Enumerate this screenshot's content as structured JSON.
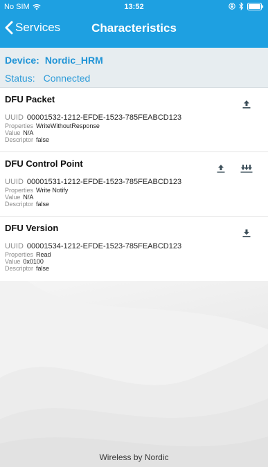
{
  "status_bar": {
    "carrier": "No SIM",
    "time": "13:52",
    "icons": [
      "wifi-icon",
      "rotation-lock-icon",
      "bluetooth-icon",
      "battery-icon"
    ]
  },
  "nav": {
    "back_label": "Services",
    "title": "Characteristics"
  },
  "device": {
    "device_label": "Device:",
    "device_value": "Nordic_HRM",
    "status_label": "Status:",
    "status_value": "Connected"
  },
  "labels": {
    "uuid": "UUID",
    "properties": "Properties",
    "value": "Value",
    "descriptor": "Descriptor"
  },
  "characteristics": [
    {
      "name": "DFU Packet",
      "uuid": "00001532-1212-EFDE-1523-785FEABCD123",
      "properties": "WriteWithoutResponse",
      "value": "N/A",
      "descriptor": "false",
      "actions": [
        "write-icon"
      ]
    },
    {
      "name": "DFU Control Point",
      "uuid": "00001531-1212-EFDE-1523-785FEABCD123",
      "properties": "Write Notify",
      "value": "N/A",
      "descriptor": "false",
      "actions": [
        "write-icon",
        "notify-icon"
      ]
    },
    {
      "name": "DFU Version",
      "uuid": "00001534-1212-EFDE-1523-785FEABCD123",
      "properties": "Read",
      "value": "0x0100",
      "descriptor": "false",
      "actions": [
        "read-icon"
      ]
    }
  ],
  "footer": {
    "text": "Wireless by Nordic"
  },
  "colors": {
    "header": "#1ea0e1",
    "device_panel": "#e7edf0",
    "accent_text": "#1e93d6",
    "action_icon": "#3d4f5a"
  }
}
